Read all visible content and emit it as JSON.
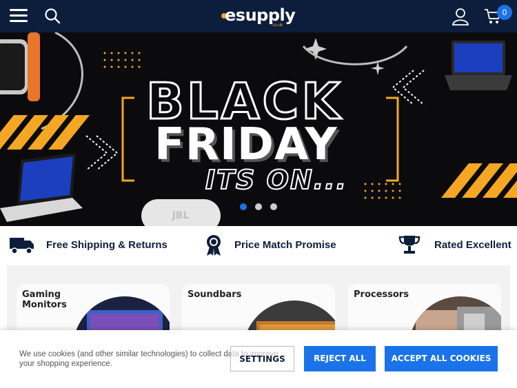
{
  "header": {
    "logo_text": "esupply",
    "logo_sub": ".co.uk",
    "cart_count": "0"
  },
  "hero": {
    "line1": "BLACK",
    "line2": "FRIDAY",
    "line3": "ITS ON...",
    "slide_count": 3,
    "active_slide": 1
  },
  "usps": [
    {
      "icon": "truck-icon",
      "label": "Free Shipping & Returns"
    },
    {
      "icon": "award-ribbon-icon",
      "label": "Price Match Promise"
    },
    {
      "icon": "trophy-icon",
      "label": "Rated Excellent"
    }
  ],
  "categories": [
    {
      "title": "Gaming Monitors"
    },
    {
      "title": "Soundbars"
    },
    {
      "title": "Processors"
    }
  ],
  "cookie": {
    "text": "We use cookies (and other similar technologies) to collect data to improve your shopping experience.",
    "settings_label": "SETTINGS",
    "reject_label": "REJECT ALL",
    "accept_label": "ACCEPT ALL COOKIES"
  },
  "colors": {
    "header_bg": "#0d1e3c",
    "accent_blue": "#1a73e8",
    "accent_orange": "#f5a623"
  }
}
